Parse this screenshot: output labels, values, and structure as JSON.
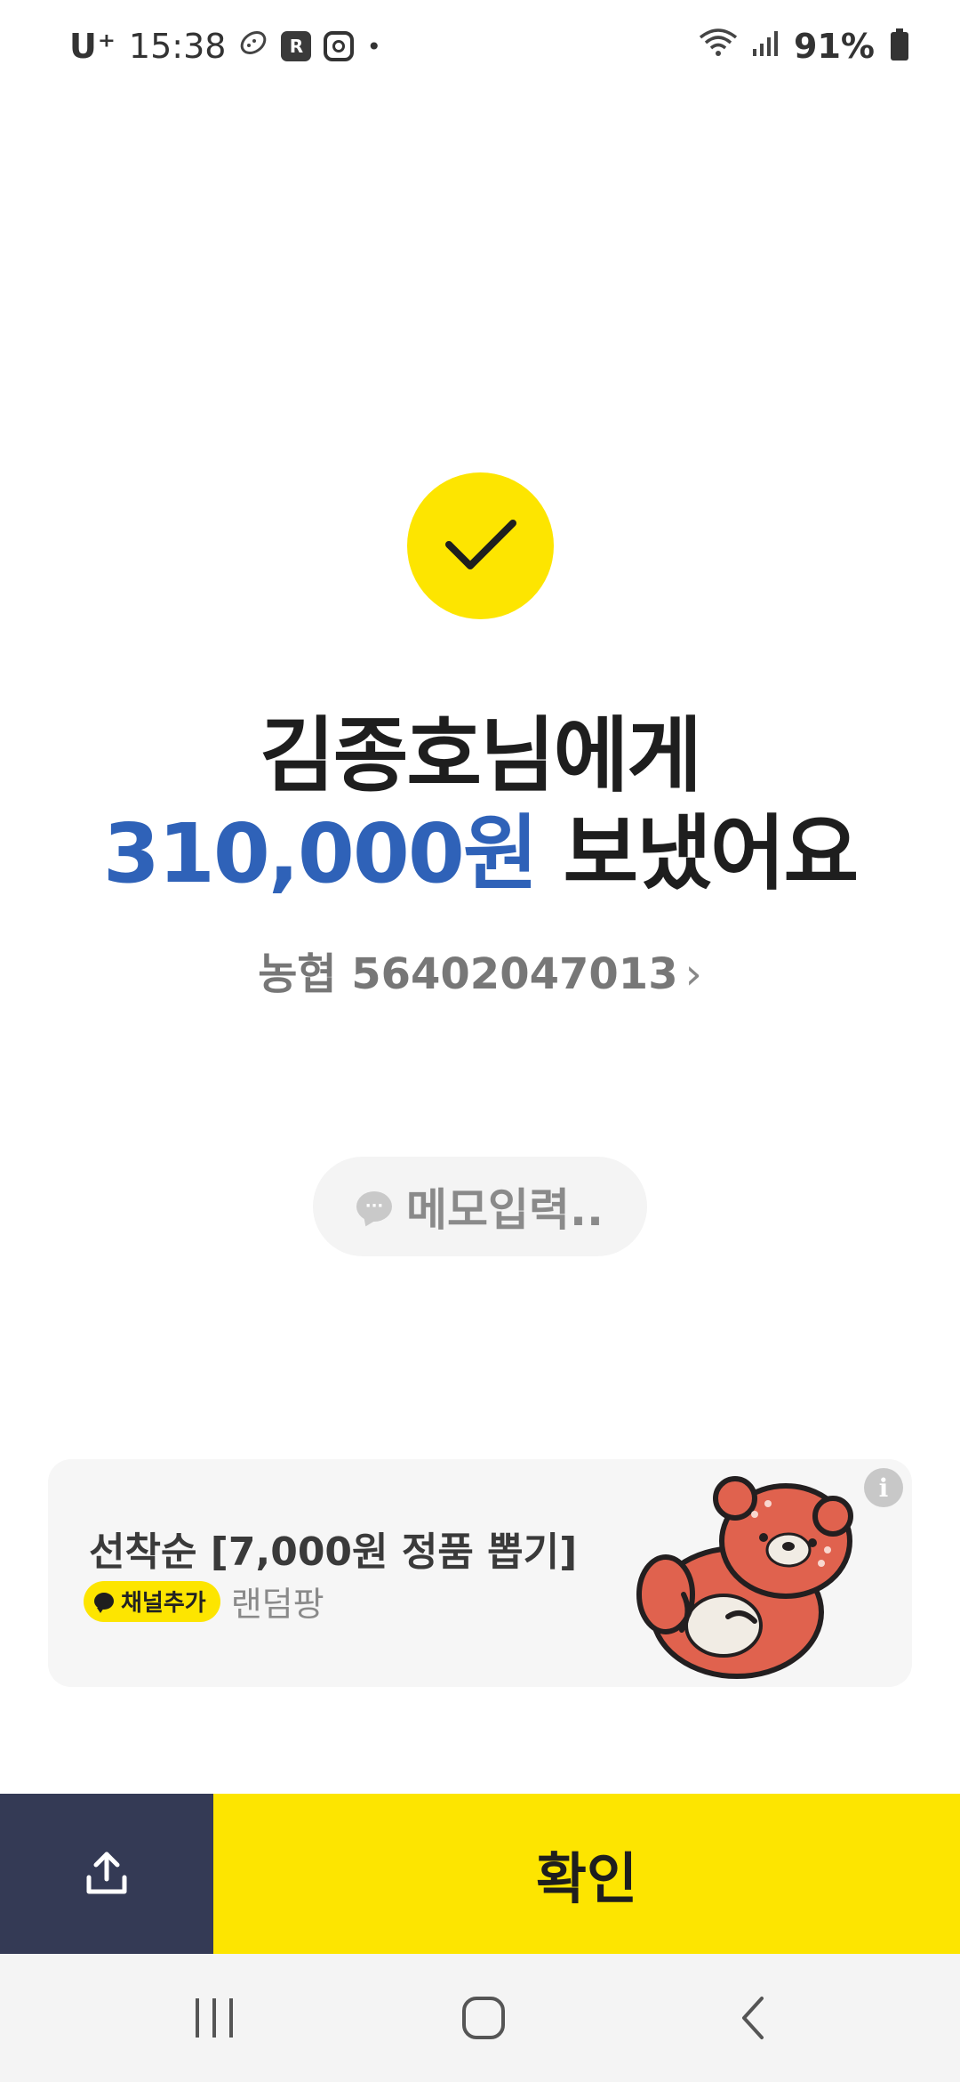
{
  "status_bar": {
    "carrier": "U⁺",
    "time": "15:38",
    "app_badge": "R",
    "dot": "•",
    "battery_percent": "91%"
  },
  "confirmation": {
    "recipient_line": "김종호님에게",
    "amount": "310,000원",
    "sent_suffix": " 보냈어요",
    "bank_account": "농협 56402047013",
    "account_chevron": "›"
  },
  "memo": {
    "placeholder_label": "메모입력..",
    "icon_glyph": "···"
  },
  "ad": {
    "title": "선착순 [7,000원 정품 뽑기]",
    "channel_badge": "채널추가",
    "brand": "랜덤팡",
    "info_glyph": "i"
  },
  "actions": {
    "confirm_label": "확인"
  },
  "colors": {
    "accent_yellow": "#fde500",
    "amount_blue": "#2f62b8",
    "share_navy": "#343a55"
  }
}
